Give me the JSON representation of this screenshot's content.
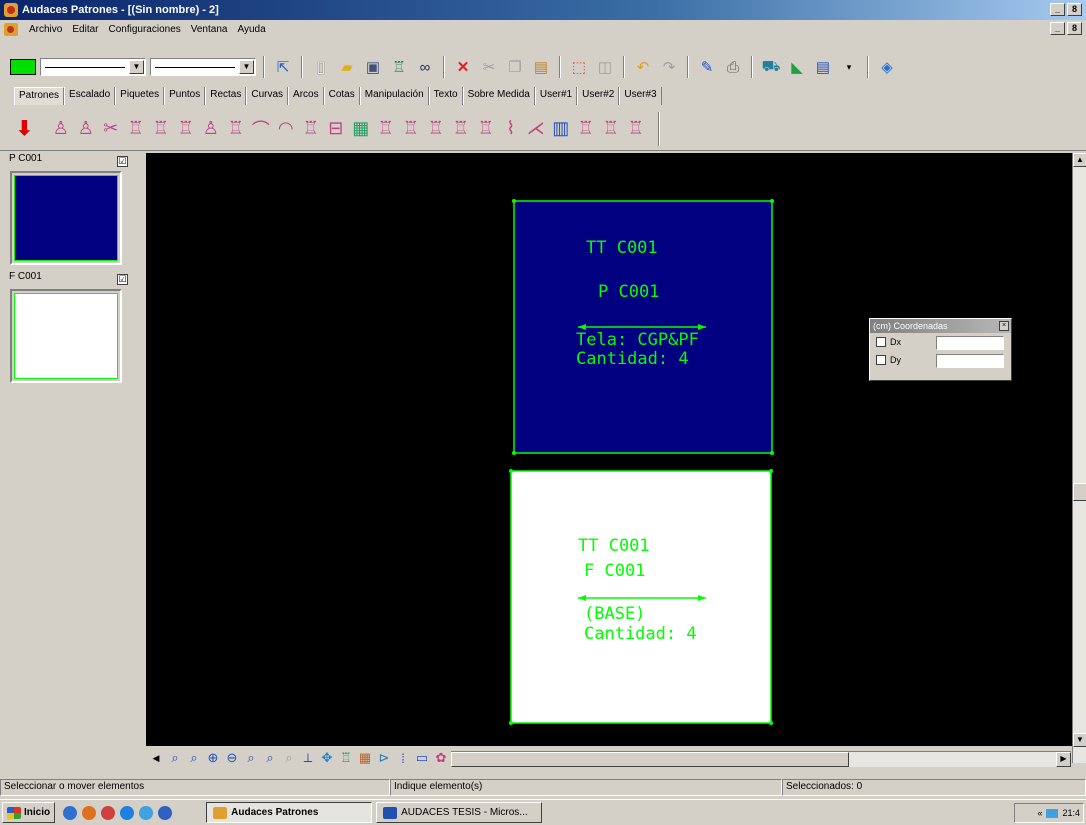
{
  "window": {
    "title": "Audaces Patrones - [(Sin nombre) - 2]",
    "min": "_",
    "restore": "8",
    "close": "×"
  },
  "menu": {
    "items": [
      "Archivo",
      "Editar",
      "Configuraciones",
      "Ventana",
      "Ayuda"
    ]
  },
  "toolbar": {
    "color_swatch": "#00e000",
    "icons": [
      "pointer-icon",
      "new-icon",
      "open-icon",
      "save-icon",
      "piece-icon",
      "binoculars-icon",
      "delete-icon",
      "cut-icon",
      "copy-icon",
      "paste-icon",
      "select-box-icon",
      "frame-icon",
      "undo-icon",
      "redo-icon",
      "edit-icon",
      "print-icon",
      "plotter-icon",
      "ruler-icon",
      "list-icon",
      "help-icon"
    ]
  },
  "tabs": [
    "Patrones",
    "Escalado",
    "Piquetes",
    "Puntos",
    "Rectas",
    "Curvas",
    "Arcos",
    "Cotas",
    "Manipulación",
    "Texto",
    "Sobre Medida",
    "User#1",
    "User#2",
    "User#3"
  ],
  "active_tab": "Patrones",
  "patterns_toolbar_count": 24,
  "pieces": [
    {
      "label": "P C001",
      "fill": "#000080",
      "checked": "☑"
    },
    {
      "label": "F C001",
      "fill": "#ffffff",
      "checked": "☑"
    }
  ],
  "canvas": {
    "piece1": {
      "fill": "#000080",
      "lines": [
        "TT C001",
        "P C001",
        "Tela: CGP&PF",
        "Cantidad: 4"
      ]
    },
    "piece2": {
      "fill": "#ffffff",
      "lines": [
        "TT C001",
        "F C001",
        "(BASE)",
        "Cantidad: 4"
      ]
    }
  },
  "coord_panel": {
    "title": "(cm) Coordenadas",
    "close": "×",
    "rows": [
      {
        "label": "Dx"
      },
      {
        "label": "Dy"
      }
    ]
  },
  "status": {
    "left": "Seleccionar o mover elementos",
    "middle": "Indique elemento(s)",
    "right": "Seleccionados: 0"
  },
  "taskbar": {
    "start": "Inicio",
    "tasks": [
      "Audaces Patrones",
      "AUDACES TESIS - Micros..."
    ],
    "clock": "21:4",
    "tray_arrows": "«"
  }
}
